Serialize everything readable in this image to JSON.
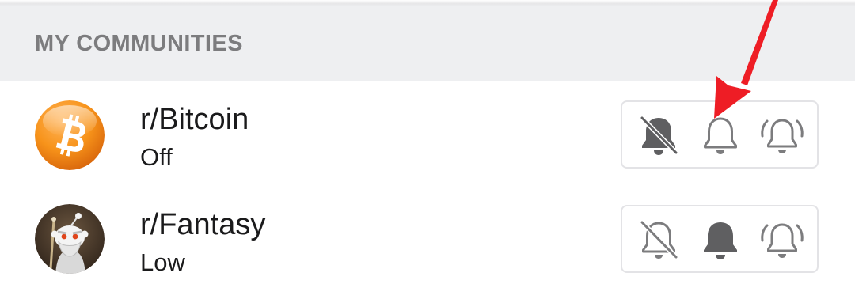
{
  "section": {
    "title": "MY COMMUNITIES"
  },
  "communities": [
    {
      "name": "r/Bitcoin",
      "notification_level": "Off",
      "avatar_icon": "bitcoin-logo-icon",
      "selected_option": "off"
    },
    {
      "name": "r/Fantasy",
      "notification_level": "Low",
      "avatar_icon": "fantasy-wizard-snoo-icon",
      "selected_option": "low"
    }
  ],
  "notification_options": [
    "off",
    "low",
    "frequent"
  ],
  "colors": {
    "header_bg": "#eeeff1",
    "header_text": "#7c7c7e",
    "icon_gray": "#7c7c7e",
    "active_icon": "#5f5f61",
    "bitcoin_orange": "#f7931a",
    "annotation_arrow": "#ee1d25"
  }
}
